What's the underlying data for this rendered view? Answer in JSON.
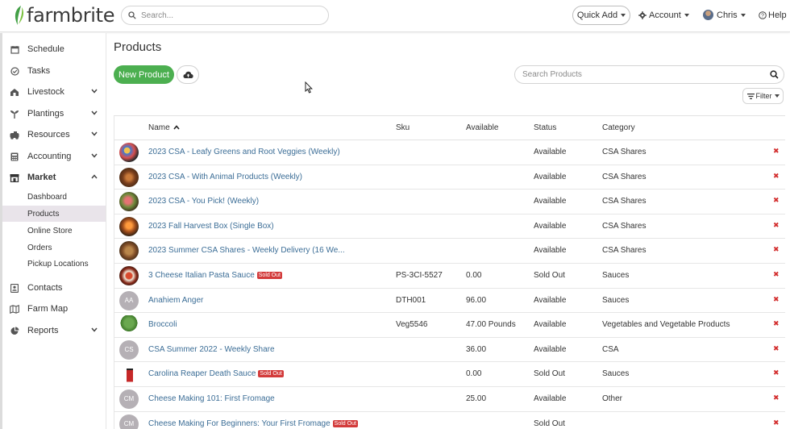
{
  "app": {
    "logo_text": "farmbrite",
    "search_placeholder": "Search...",
    "quick_add_label": "Quick Add",
    "account_label": "Account",
    "user_label": "Chris",
    "help_label": "Help"
  },
  "sidebar": {
    "items": [
      {
        "label": "Schedule",
        "icon": "calendar-icon"
      },
      {
        "label": "Tasks",
        "icon": "check-circle-icon"
      },
      {
        "label": "Livestock",
        "icon": "livestock-icon"
      },
      {
        "label": "Plantings",
        "icon": "sprout-icon"
      },
      {
        "label": "Resources",
        "icon": "resources-icon"
      },
      {
        "label": "Accounting",
        "icon": "calculator-icon"
      },
      {
        "label": "Market",
        "icon": "store-icon"
      },
      {
        "label": "Contacts",
        "icon": "contacts-icon"
      },
      {
        "label": "Farm Map",
        "icon": "map-icon"
      },
      {
        "label": "Reports",
        "icon": "pie-chart-icon"
      }
    ],
    "market_subitems": [
      "Dashboard",
      "Products",
      "Online Store",
      "Orders",
      "Pickup Locations"
    ],
    "active_subitem": "Products"
  },
  "main": {
    "title": "Products",
    "new_product_label": "New Product",
    "search_placeholder": "Search Products",
    "filter_label": "Filter",
    "columns": {
      "name": "Name",
      "sku": "Sku",
      "available": "Available",
      "status": "Status",
      "category": "Category"
    },
    "sold_out_badge": "Sold Out",
    "rows": [
      {
        "name": "2023 CSA - Leafy Greens and Root Veggies (Weekly)",
        "sku": "",
        "available": "",
        "status": "Available",
        "category": "CSA Shares",
        "thumb": "image",
        "sold_out": false
      },
      {
        "name": "2023 CSA - With Animal Products (Weekly)",
        "sku": "",
        "available": "",
        "status": "Available",
        "category": "CSA Shares",
        "thumb": "image",
        "sold_out": false
      },
      {
        "name": "2023 CSA - You Pick! (Weekly)",
        "sku": "",
        "available": "",
        "status": "Available",
        "category": "CSA Shares",
        "thumb": "image",
        "sold_out": false
      },
      {
        "name": "2023 Fall Harvest Box (Single Box)",
        "sku": "",
        "available": "",
        "status": "Available",
        "category": "CSA Shares",
        "thumb": "image",
        "sold_out": false
      },
      {
        "name": "2023 Summer CSA Shares - Weekly Delivery (16 We...",
        "sku": "",
        "available": "",
        "status": "Available",
        "category": "CSA Shares",
        "thumb": "image",
        "sold_out": false
      },
      {
        "name": "3 Cheese Italian Pasta Sauce",
        "sku": "PS-3CI-5527",
        "available": "0.00",
        "status": "Sold Out",
        "category": "Sauces",
        "thumb": "image",
        "sold_out": true
      },
      {
        "name": "Anahiem Anger",
        "sku": "DTH001",
        "available": "96.00",
        "status": "Available",
        "category": "Sauces",
        "thumb": "AA",
        "sold_out": false
      },
      {
        "name": "Broccoli",
        "sku": "Veg5546",
        "available": "47.00 Pounds",
        "status": "Available",
        "category": "Vegetables and Vegetable Products",
        "thumb": "image",
        "sold_out": false
      },
      {
        "name": "CSA Summer 2022 - Weekly Share",
        "sku": "",
        "available": "36.00",
        "status": "Available",
        "category": "CSA",
        "thumb": "CS",
        "sold_out": false
      },
      {
        "name": "Carolina Reaper Death Sauce",
        "sku": "",
        "available": "0.00",
        "status": "Sold Out",
        "category": "Sauces",
        "thumb": "image",
        "sold_out": true
      },
      {
        "name": "Cheese Making 101: First Fromage",
        "sku": "",
        "available": "25.00",
        "status": "Available",
        "category": "Other",
        "thumb": "CM",
        "sold_out": false
      },
      {
        "name": "Cheese Making For Beginners: Your First Fromage",
        "sku": "",
        "available": "",
        "status": "Sold Out",
        "category": "",
        "thumb": "CM",
        "sold_out": true
      }
    ]
  },
  "colors": {
    "brand_green": "#4caf50",
    "link_blue": "#3b6d96",
    "danger_red": "#d32f2f"
  }
}
